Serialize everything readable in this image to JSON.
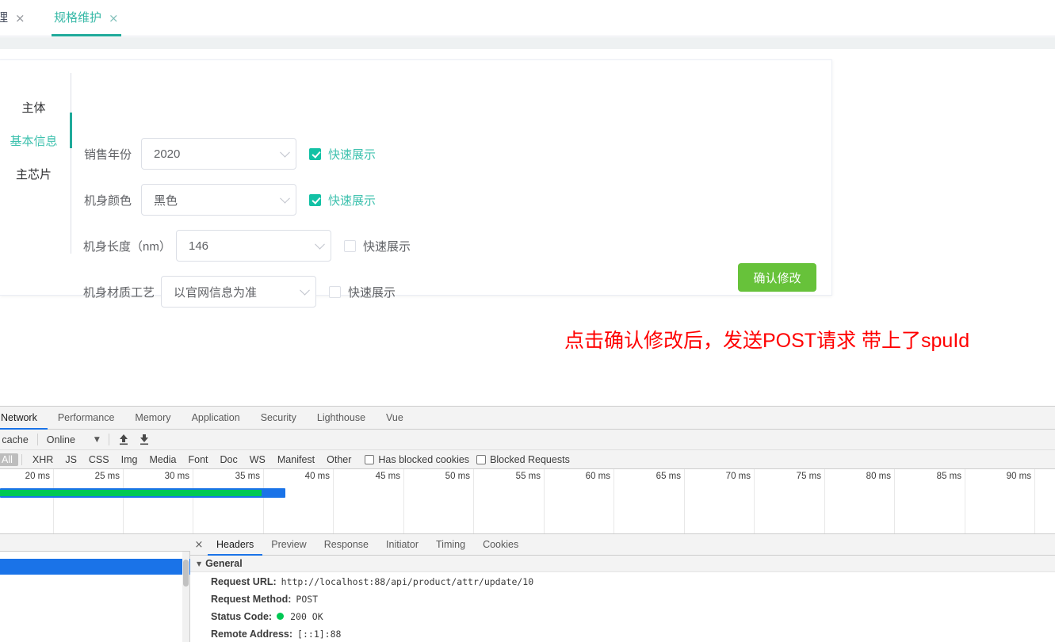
{
  "browser_tabs": [
    {
      "label": "理",
      "close": "×",
      "active": false
    },
    {
      "label": "规格维护",
      "close": "×",
      "active": true
    }
  ],
  "steps": [
    {
      "label": "主体",
      "active": false
    },
    {
      "label": "基本信息",
      "active": true
    },
    {
      "label": "主芯片",
      "active": false
    }
  ],
  "form": {
    "rows": [
      {
        "label": "销售年份",
        "value": "2020",
        "checked": true,
        "check_label": "快速展示"
      },
      {
        "label": "机身颜色",
        "value": "黑色",
        "checked": true,
        "check_label": "快速展示"
      },
      {
        "label": "机身长度（nm）",
        "value": "146",
        "checked": false,
        "check_label": "快速展示"
      },
      {
        "label": "机身材质工艺",
        "value": "以官网信息为准",
        "checked": false,
        "check_label": "快速展示"
      }
    ],
    "submit_label": "确认修改"
  },
  "annotation": "点击确认修改后，发送POST请求 带上了spuId",
  "devtools": {
    "panel_tabs": [
      {
        "label": "Network",
        "active": true
      },
      {
        "label": "Performance",
        "active": false
      },
      {
        "label": "Memory",
        "active": false
      },
      {
        "label": "Application",
        "active": false
      },
      {
        "label": "Security",
        "active": false
      },
      {
        "label": "Lighthouse",
        "active": false
      },
      {
        "label": "Vue",
        "active": false
      }
    ],
    "toolbar": {
      "cache_label": "e cache",
      "throttle_value": "Online",
      "throttle_caret": "▼"
    },
    "filters": {
      "types": [
        "All",
        "XHR",
        "JS",
        "CSS",
        "Img",
        "Media",
        "Font",
        "Doc",
        "WS",
        "Manifest",
        "Other"
      ],
      "active_type": "All",
      "checkboxes": [
        {
          "label": "Has blocked cookies",
          "checked": false
        },
        {
          "label": "Blocked Requests",
          "checked": false
        }
      ]
    },
    "timeline": {
      "ticks": [
        "20 ms",
        "25 ms",
        "30 ms",
        "35 ms",
        "40 ms",
        "45 ms",
        "50 ms",
        "55 ms",
        "60 ms",
        "65 ms",
        "70 ms",
        "75 ms",
        "80 ms",
        "85 ms",
        "90 ms"
      ],
      "bar_color_outer": "#1a73e8",
      "bar_color_inner": "#00c853"
    },
    "detail_tabs": [
      {
        "label": "Headers",
        "active": true
      },
      {
        "label": "Preview",
        "active": false
      },
      {
        "label": "Response",
        "active": false
      },
      {
        "label": "Initiator",
        "active": false
      },
      {
        "label": "Timing",
        "active": false
      },
      {
        "label": "Cookies",
        "active": false
      }
    ],
    "detail_close": "×",
    "general": {
      "section_title": "General",
      "caret": "▼",
      "rows": [
        {
          "key": "Request URL:",
          "value": "http://localhost:88/api/product/attr/update/10"
        },
        {
          "key": "Request Method:",
          "value": "POST"
        },
        {
          "key": "Status Code:",
          "value": "200 OK",
          "has_status_dot": true
        },
        {
          "key": "Remote Address:",
          "value": "[::1]:88"
        }
      ]
    }
  }
}
